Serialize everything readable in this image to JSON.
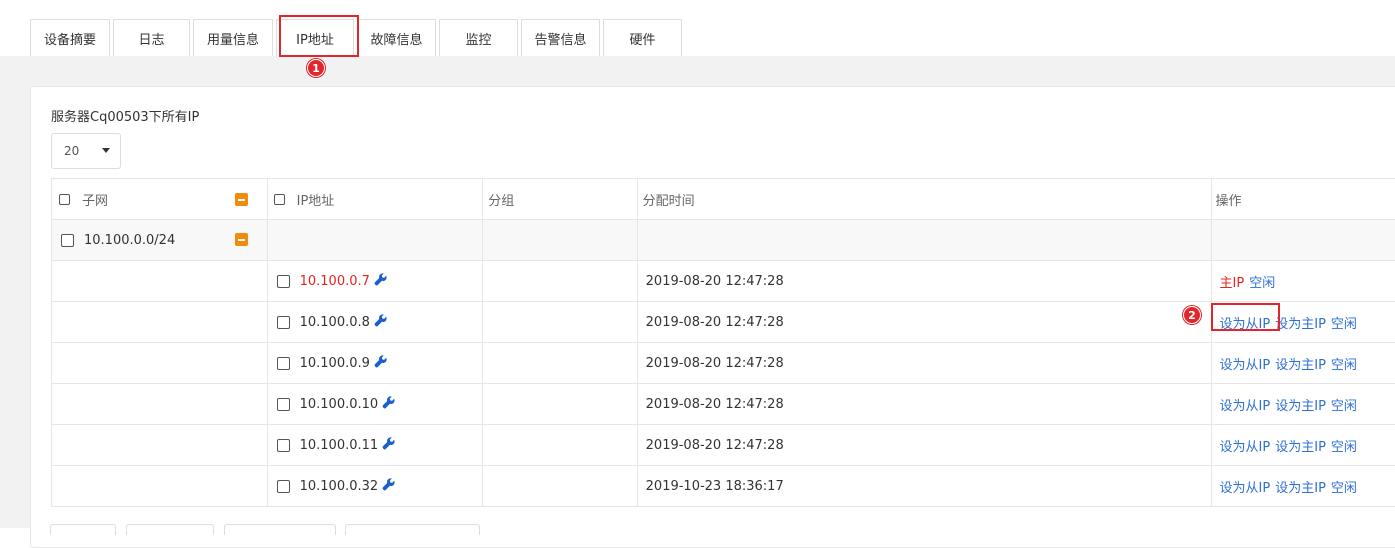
{
  "tabs": [
    {
      "label": "设备摘要"
    },
    {
      "label": "日志"
    },
    {
      "label": "用量信息"
    },
    {
      "label": "IP地址"
    },
    {
      "label": "故障信息"
    },
    {
      "label": "监控"
    },
    {
      "label": "告警信息"
    },
    {
      "label": "硬件"
    }
  ],
  "panel": {
    "title": "服务器Cq00503下所有IP",
    "page_size": "20"
  },
  "table": {
    "headers": {
      "subnet": "子网",
      "ip": "IP地址",
      "group": "分组",
      "time": "分配时间",
      "ops": "操作"
    },
    "subnet": "10.100.0.0/24",
    "rows": [
      {
        "ip": "10.100.0.7",
        "time": "2019-08-20 12:47:28",
        "primary_label": "主IP",
        "idle": "空闲"
      },
      {
        "ip": "10.100.0.8",
        "time": "2019-08-20 12:47:28",
        "set_secondary": "设为从IP",
        "set_primary": "设为主IP",
        "idle": "空闲"
      },
      {
        "ip": "10.100.0.9",
        "time": "2019-08-20 12:47:28",
        "set_secondary": "设为从IP",
        "set_primary": "设为主IP",
        "idle": "空闲"
      },
      {
        "ip": "10.100.0.10",
        "time": "2019-08-20 12:47:28",
        "set_secondary": "设为从IP",
        "set_primary": "设为主IP",
        "idle": "空闲"
      },
      {
        "ip": "10.100.0.11",
        "time": "2019-08-20 12:47:28",
        "set_secondary": "设为从IP",
        "set_primary": "设为主IP",
        "idle": "空闲"
      },
      {
        "ip": "10.100.0.32",
        "time": "2019-10-23 18:36:17",
        "set_secondary": "设为从IP",
        "set_primary": "设为主IP",
        "idle": "空闲"
      }
    ]
  },
  "annotations": {
    "step1": "1",
    "step2": "2",
    "highlight_color": "#e3262b"
  },
  "colors": {
    "link": "#2e6fd6",
    "primary_ip": "#e8231d",
    "collapse": "#f28b0c"
  },
  "icons": {
    "ip_action": "wrench-icon",
    "collapse": "minus-square-icon",
    "page_size_toggle": "caret-down-icon"
  }
}
